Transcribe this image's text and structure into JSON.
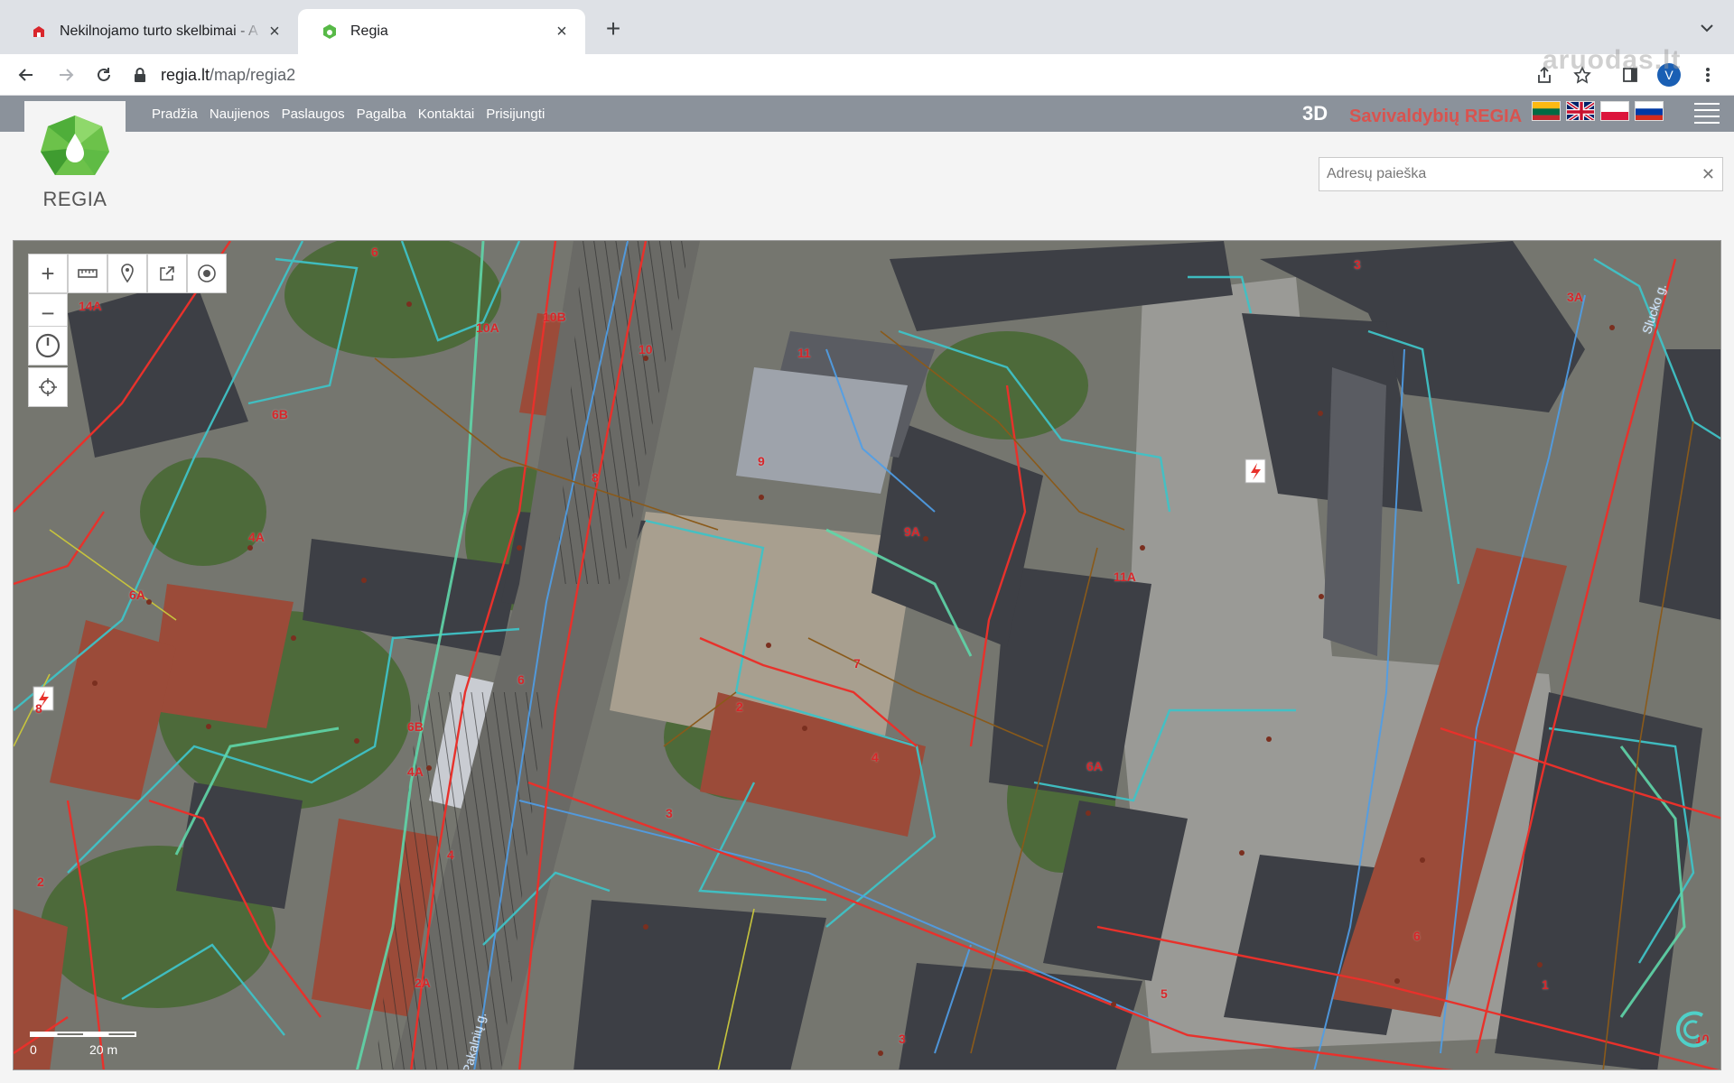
{
  "browser": {
    "tabs": [
      {
        "title": "Nekilnojamo turto skelbimai - A"
      },
      {
        "title": "Regia"
      }
    ],
    "url_host": "regia.lt",
    "url_path": "/map/regia2",
    "profile_initial": "V"
  },
  "watermark": "aruodas.lt",
  "site": {
    "logo_text": "REGIA",
    "nav": [
      "Pradžia",
      "Naujienos",
      "Paslaugos",
      "Pagalba",
      "Kontaktai",
      "Prisijungti"
    ],
    "mode_3d": "3D",
    "brand": "Savivaldybių REGIA",
    "search_placeholder": "Adresų paieška"
  },
  "map": {
    "building_labels": [
      "6",
      "14A",
      "10A",
      "10B",
      "10",
      "11",
      "3",
      "3A",
      "6B",
      "8",
      "9",
      "9A",
      "4A",
      "6A",
      "11A",
      "7",
      "2",
      "8",
      "6",
      "6B",
      "4A",
      "4",
      "6A",
      "3",
      "4",
      "2",
      "2A",
      "5",
      "1",
      "6",
      "3",
      "10"
    ],
    "street_labels": [
      "Slucko g.",
      "Pakalnių g."
    ],
    "scale": {
      "start": "0",
      "end": "20 m"
    }
  }
}
